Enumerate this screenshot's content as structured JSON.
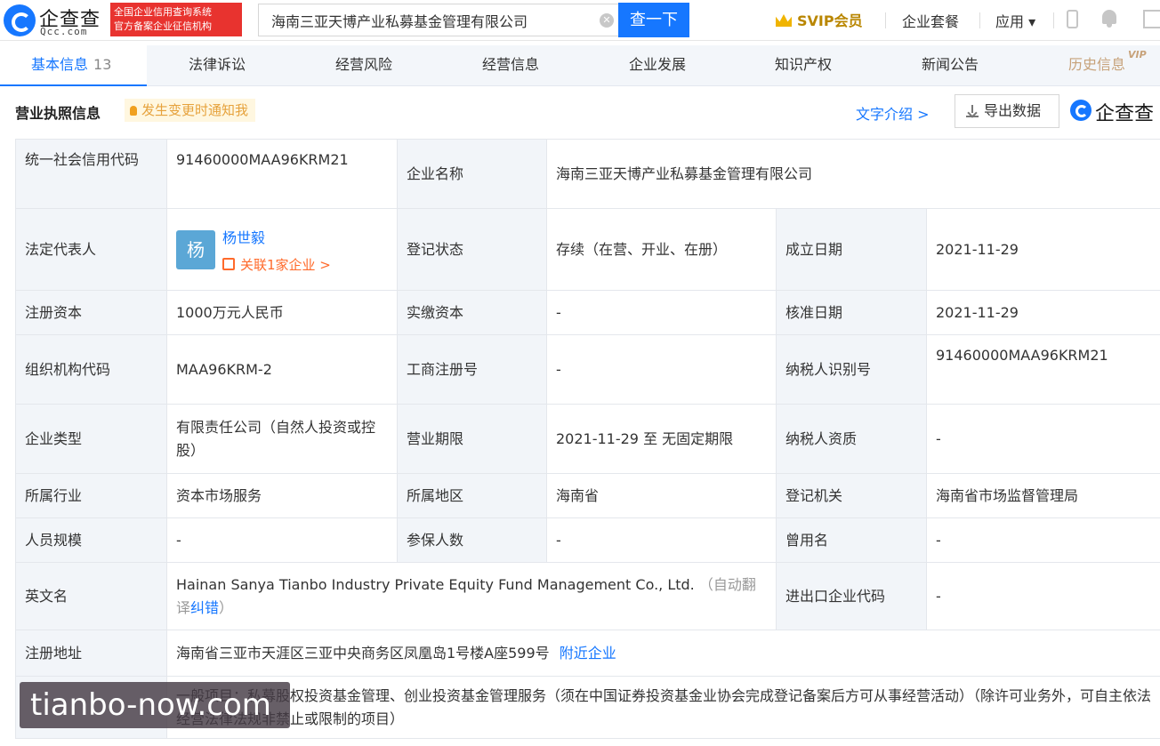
{
  "header": {
    "logo_cn": "企查查",
    "logo_en": "Qcc.com",
    "badge_line1": "全国企业信用查询系统",
    "badge_line2": "官方备案企业征信机构",
    "search_value": "海南三亚天博产业私募基金管理有限公司",
    "search_button": "查一下",
    "svip": "SVIP会员",
    "package": "企业套餐",
    "apps": "应用 ▾"
  },
  "tabs": [
    {
      "label": "基本信息",
      "count": "13"
    },
    {
      "label": "法律诉讼"
    },
    {
      "label": "经营风险"
    },
    {
      "label": "经营信息"
    },
    {
      "label": "企业发展"
    },
    {
      "label": "知识产权"
    },
    {
      "label": "新闻公告"
    },
    {
      "label": "历史信息",
      "sup": "VIP"
    }
  ],
  "section": {
    "title": "营业执照信息",
    "notify": "发生变更时通知我",
    "text_intro": "文字介绍 >",
    "export": "导出数据",
    "brand": "企查查"
  },
  "info": {
    "credit_code_label": "统一社会信用代码",
    "credit_code": "91460000MAA96KRM21",
    "company_name_label": "企业名称",
    "company_name": "海南三亚天博产业私募基金管理有限公司",
    "legal_rep_label": "法定代表人",
    "legal_avatar": "杨",
    "legal_rep": "杨世毅",
    "legal_related": "关联1家企业 >",
    "reg_status_label": "登记状态",
    "reg_status": "存续（在营、开业、在册）",
    "found_date_label": "成立日期",
    "found_date": "2021-11-29",
    "reg_capital_label": "注册资本",
    "reg_capital": "1000万元人民币",
    "paid_capital_label": "实缴资本",
    "paid_capital": "-",
    "approve_date_label": "核准日期",
    "approve_date": "2021-11-29",
    "org_code_label": "组织机构代码",
    "org_code": "MAA96KRM-2",
    "biz_reg_no_label": "工商注册号",
    "biz_reg_no": "-",
    "taxpayer_id_label": "纳税人识别号",
    "taxpayer_id": "91460000MAA96KRM21",
    "company_type_label": "企业类型",
    "company_type": "有限责任公司（自然人投资或控股）",
    "biz_term_label": "营业期限",
    "biz_term": "2021-11-29 至 无固定期限",
    "taxpayer_qual_label": "纳税人资质",
    "taxpayer_qual": "-",
    "industry_label": "所属行业",
    "industry": "资本市场服务",
    "region_label": "所属地区",
    "region": "海南省",
    "reg_authority_label": "登记机关",
    "reg_authority": "海南省市场监督管理局",
    "staff_size_label": "人员规模",
    "staff_size": "-",
    "insured_label": "参保人数",
    "insured": "-",
    "former_name_label": "曾用名",
    "former_name": "-",
    "english_name_label": "英文名",
    "english_name": "Hainan Sanya Tianbo Industry Private Equity Fund Management Co., Ltd.",
    "auto_translate_prefix": "（自动翻译",
    "correct_error": "纠错",
    "auto_translate_suffix": "）",
    "import_export_label": "进出口企业代码",
    "import_export": "-",
    "address_label": "注册地址",
    "address": "海南省三亚市天涯区三亚中央商务区凤凰岛1号楼A座599号",
    "nearby": "附近企业",
    "scope": "一般项目：私募股权投资基金管理、创业投资基金管理服务（须在中国证券投资基金业协会完成登记备案后方可从事经营活动）（除许可业务外，可自主依法经营法律法规非禁止或限制的项目）"
  },
  "watermark": "tianbo-now.com"
}
